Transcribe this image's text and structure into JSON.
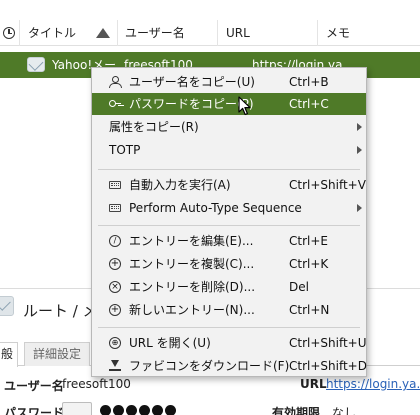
{
  "columns": {
    "title": "タイトル",
    "user": "ユーザー名",
    "url": "URL",
    "memo": "メモ"
  },
  "entry": {
    "title": "Yahoo!メール",
    "user": "freesoft100",
    "url": "https://login.ya..."
  },
  "context_menu": {
    "copy_user": {
      "label": "ユーザー名をコピー(U)",
      "shortcut": "Ctrl+B"
    },
    "copy_password": {
      "label": "パスワードをコピー(P)",
      "shortcut": "Ctrl+C"
    },
    "copy_attribute": {
      "label": "属性をコピー(R)"
    },
    "totp": {
      "label": "TOTP"
    },
    "auto_type": {
      "label": "自動入力を実行(A)",
      "shortcut": "Ctrl+Shift+V"
    },
    "auto_type_seq": {
      "label": "Perform Auto-Type Sequence"
    },
    "edit": {
      "label": "エントリーを編集(E)...",
      "shortcut": "Ctrl+E"
    },
    "duplicate": {
      "label": "エントリーを複製(C)...",
      "shortcut": "Ctrl+K"
    },
    "delete": {
      "label": "エントリーを削除(D)...",
      "shortcut": "Del"
    },
    "new": {
      "label": "新しいエントリー(N)...",
      "shortcut": "Ctrl+N"
    },
    "open_url": {
      "label": "URL を開く(U)",
      "shortcut": "Ctrl+Shift+U"
    },
    "download_favicon": {
      "label": "ファビコンをダウンロード(F)",
      "shortcut": "Ctrl+Shift+D"
    }
  },
  "detail": {
    "path": "ルート / メー",
    "tab_general": "般",
    "tab_advanced": "詳細設定",
    "user_label": "ユーザー名",
    "user_value": "freesoft100",
    "url_label": "URL",
    "url_value": "https://login.ya...",
    "password_label": "パスワード",
    "expiry_label": "有効期限",
    "expiry_value": "なし"
  },
  "colors": {
    "selection": "#4f7a28",
    "menu_bg": "#f2f2f2"
  },
  "icons": [
    "clock-icon",
    "sort-up-icon",
    "mail-entry-icon",
    "user-icon",
    "key-icon",
    "keyboard-icon",
    "edit-icon",
    "clone-icon",
    "delete-icon",
    "add-icon",
    "globe-icon",
    "download-icon",
    "eye-icon"
  ]
}
